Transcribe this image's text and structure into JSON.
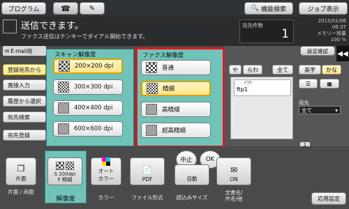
{
  "header": {
    "program_label": "プログラム",
    "search_label": "機能検索",
    "job_label": "ジョブ表示"
  },
  "status": {
    "title": "送信できます。",
    "message": "ファクス送信はテンキーでダイアル開始できます。",
    "dest_count_label": "宛先件数",
    "dest_count": "1",
    "date": "2015/01/06",
    "time": "06:37",
    "memory_label": "メモリー残量",
    "memory_value": "100 %"
  },
  "side_menu": {
    "email_label": "E-mail宛",
    "items": [
      "登録宛先から",
      "直接入力",
      "履歴から選択",
      "宛先検索",
      "宛先登録"
    ]
  },
  "right_panel": {
    "settings_confirm": "設定確認",
    "tabs": [
      "や",
      "らわ",
      "全て",
      "英字",
      "かな"
    ],
    "ftp_small": "FTP",
    "ftp_name": "ftp1",
    "dest_label": "宛先",
    "dest_value": "全て",
    "apply_settings": "応用設定"
  },
  "scan_panel": {
    "title": "スキャン解像度",
    "options": [
      "200×200 dpi",
      "300×300 dpi",
      "400×400 dpi",
      "600×600 dpi"
    ],
    "selected_index": 0
  },
  "fax_panel": {
    "title": "ファクス解像度",
    "options": [
      "普通",
      "精細",
      "高精細",
      "超高精細"
    ],
    "selected_index": 1
  },
  "actions": {
    "stop": "中止",
    "ok": "OK"
  },
  "bottom_tiles": [
    {
      "text": "片面",
      "label": "片面 / 両面"
    },
    {
      "text": "S 200dpi\nF 精細",
      "label": "解像度"
    },
    {
      "text": "オート\nカラー",
      "label": "カラー"
    },
    {
      "text": "PDF",
      "label": "ファイル形式"
    },
    {
      "text": "自動",
      "label": "読込みサイズ"
    },
    {
      "text": "ON",
      "label": "文書名/\n件名/他"
    }
  ],
  "page_number": "1"
}
